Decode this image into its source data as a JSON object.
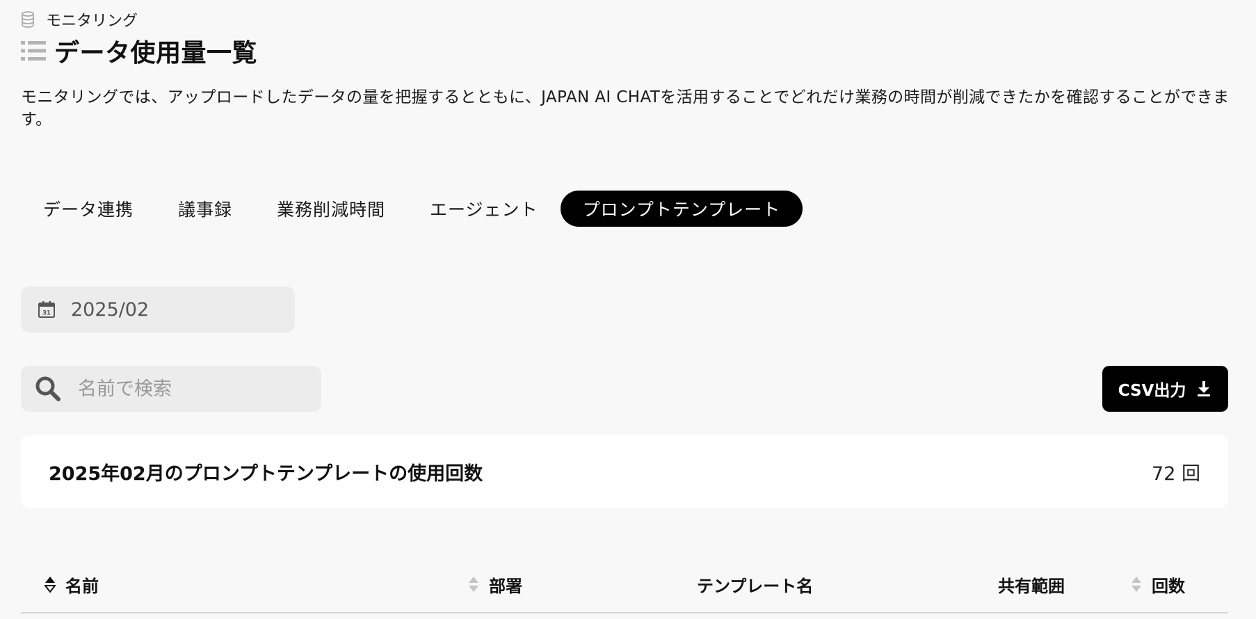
{
  "breadcrumb": {
    "label": "モニタリング",
    "icon": "database-icon"
  },
  "page": {
    "title": "データ使用量一覧",
    "title_icon": "list-icon",
    "description": "モニタリングでは、アップロードしたデータの量を把握するとともに、JAPAN AI CHATを活用することでどれだけ業務の時間が削減できたかを確認することができます。"
  },
  "tabs": [
    {
      "label": "データ連携",
      "active": false
    },
    {
      "label": "議事録",
      "active": false
    },
    {
      "label": "業務削減時間",
      "active": false
    },
    {
      "label": "エージェント",
      "active": false
    },
    {
      "label": "プロンプトテンプレート",
      "active": true
    }
  ],
  "date_picker": {
    "value": "2025/02",
    "icon": "calendar-icon",
    "icon_day": "31"
  },
  "search": {
    "placeholder": "名前で検索",
    "value": "",
    "icon": "search-icon"
  },
  "csv_button": {
    "label": "CSV出力",
    "icon": "download-icon"
  },
  "summary": {
    "label": "2025年02月のプロンプトテンプレートの使用回数",
    "count": "72 回"
  },
  "table": {
    "columns": [
      {
        "label": "名前",
        "sortable": true,
        "sort_state": "active"
      },
      {
        "label": "部署",
        "sortable": true,
        "sort_state": "none"
      },
      {
        "label": "テンプレート名",
        "sortable": false
      },
      {
        "label": "共有範囲",
        "sortable": false
      },
      {
        "label": "回数",
        "sortable": true,
        "sort_state": "none"
      }
    ]
  },
  "colors": {
    "background": "#f8f8f8",
    "active_tab": "#000000",
    "input_background": "#ececec",
    "card_background": "#ffffff"
  }
}
